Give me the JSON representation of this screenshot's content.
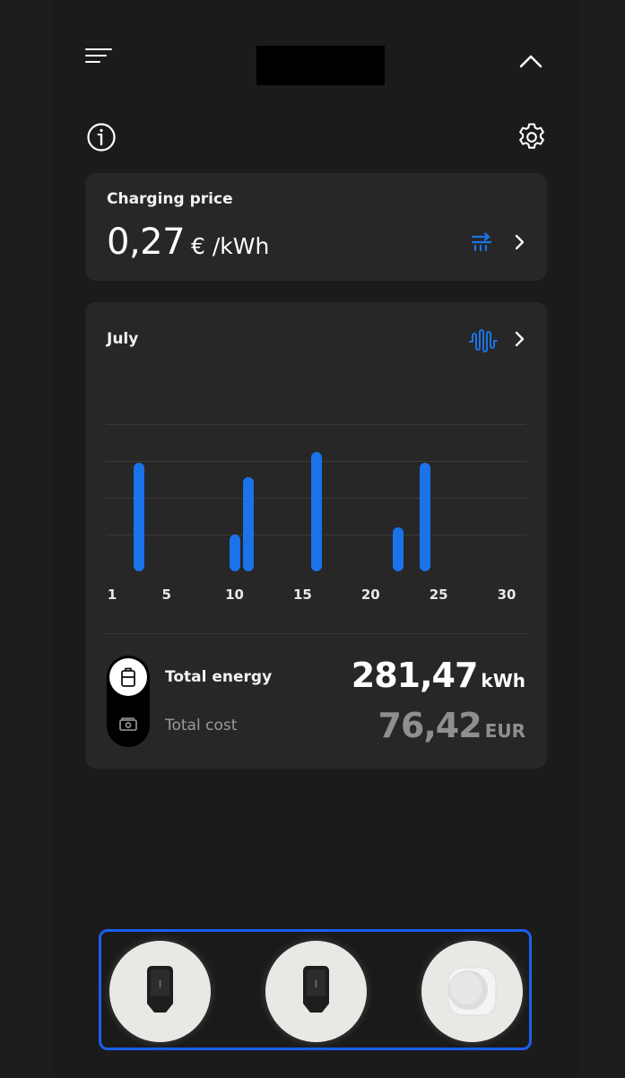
{
  "header": {
    "menu_icon": "menu-icon",
    "collapse_icon": "chevron-up-icon"
  },
  "toolbar": {
    "info_icon": "info-icon",
    "settings_icon": "gear-icon"
  },
  "price_card": {
    "label": "Charging price",
    "value": "0,27",
    "unit": "€ /kWh",
    "tariff_icon": "tariff-icon",
    "accent": "#1a73e8"
  },
  "stats_card": {
    "month": "July",
    "graph_icon": "waveform-icon",
    "total_energy_label": "Total energy",
    "total_energy_value": "281,47",
    "total_energy_unit": "kWh",
    "total_cost_label": "Total cost",
    "total_cost_value": "76,42",
    "total_cost_unit": "EUR"
  },
  "chart_data": {
    "type": "bar",
    "x_ticks": [
      "1",
      "5",
      "10",
      "15",
      "20",
      "25",
      "30"
    ],
    "x": [
      3,
      10,
      11,
      16,
      22,
      24
    ],
    "values": [
      59,
      20,
      51,
      65,
      24,
      59
    ],
    "xlim": [
      1,
      30
    ],
    "ylim": [
      0,
      80
    ],
    "grid": true,
    "color": "#1a73e8"
  },
  "devices": [
    {
      "name": "wallbox-charger-1",
      "icon": "wallbox-icon"
    },
    {
      "name": "wallbox-charger-2",
      "icon": "wallbox-icon"
    },
    {
      "name": "round-charger",
      "icon": "round-device-icon"
    }
  ]
}
